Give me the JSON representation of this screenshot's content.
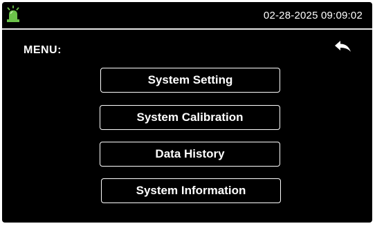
{
  "status_bar": {
    "datetime": "02-28-2025 09:09:02",
    "alarm_icon": "alarm-beacon-icon",
    "alarm_color": "#6cc24a"
  },
  "menu": {
    "title": "MENU:",
    "back_icon": "back-arrow-icon",
    "items": [
      {
        "label": "System Setting"
      },
      {
        "label": "System Calibration"
      },
      {
        "label": "Data History"
      },
      {
        "label": "System Information"
      }
    ]
  },
  "colors": {
    "background": "#000000",
    "foreground": "#ffffff"
  }
}
